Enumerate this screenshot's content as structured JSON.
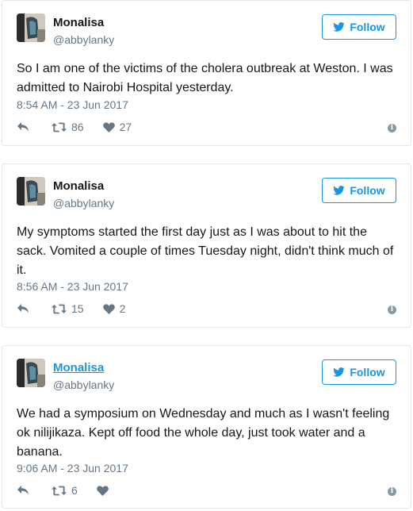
{
  "colors": {
    "accent": "#1b95e0",
    "muted": "#657786",
    "border": "#e1e8ed",
    "text": "#14171a"
  },
  "tweets": [
    {
      "name": "Monalisa",
      "handle": "@abbylanky",
      "follow_label": "Follow",
      "text": "So I am one of the victims of the cholera outbreak at Weston. I was admitted to Nairobi Hospital yesterday.",
      "time": "8:54 AM - 23 Jun 2017",
      "retweets": "86",
      "likes": "27",
      "icons": [
        "reply-icon",
        "retweet-icon",
        "heart-icon",
        "info-icon",
        "twitter-bird-icon"
      ]
    },
    {
      "name": "Monalisa",
      "handle": "@abbylanky",
      "follow_label": "Follow",
      "text": "My symptoms started the first day just as I was about to hit the sack. Vomited a couple of times Tuesday night, didn't think much of it.",
      "time": "8:56 AM - 23 Jun 2017",
      "retweets": "15",
      "likes": "2"
    },
    {
      "name": "Monalisa",
      "handle": "@abbylanky",
      "follow_label": "Follow",
      "text": "We had a symposium on Wednesday and much as I wasn't feeling ok nilijikaza. Kept off food the whole day, just took water and a banana.",
      "time": "9:06 AM - 23 Jun 2017",
      "retweets": "6",
      "likes": ""
    }
  ]
}
